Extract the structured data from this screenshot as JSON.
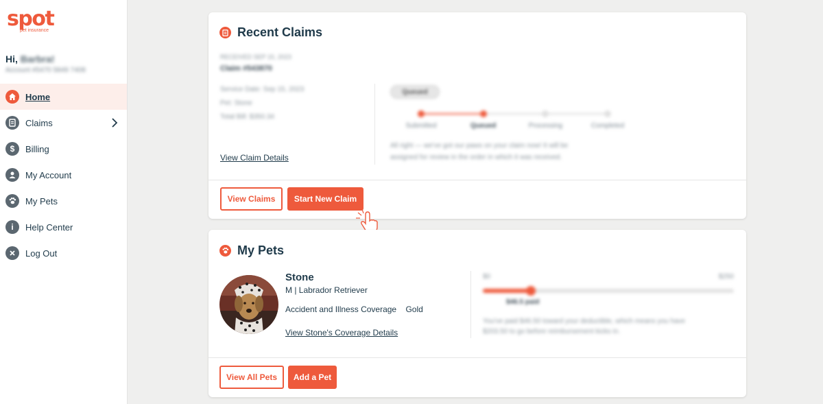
{
  "brand": {
    "logo_text": "spot",
    "logo_subtext": "pet insurance",
    "accent": "#ee5a3c",
    "navy": "#1f3a4a"
  },
  "user": {
    "greeting_prefix": "Hi, ",
    "name": "Barbra!",
    "account": "Account #5470 5849 7408"
  },
  "sidebar": {
    "items": [
      {
        "label": "Home",
        "icon": "home-icon",
        "active": true
      },
      {
        "label": "Claims",
        "icon": "clipboard-icon",
        "has_chevron": true
      },
      {
        "label": "Billing",
        "icon": "dollar-icon"
      },
      {
        "label": "My Account",
        "icon": "user-icon"
      },
      {
        "label": "My Pets",
        "icon": "paw-icon"
      },
      {
        "label": "Help Center",
        "icon": "info-icon"
      },
      {
        "label": "Log Out",
        "icon": "close-icon"
      }
    ]
  },
  "claims": {
    "title": "Recent Claims",
    "received": "RECEIVED SEP 15, 2023",
    "claim_number": "Claim #543870",
    "service_date": "Service Date: Sep 15, 2023",
    "pet": "Pet: Stone",
    "total_bill": "Total Bill: $350.34",
    "view_details_link": "View Claim Details",
    "status_pill": "Queued",
    "steps": [
      "Submitted",
      "Queued",
      "Processing",
      "Completed"
    ],
    "current_step": 2,
    "message_line1": "All right — we've got our paws on your claim now! It will be",
    "message_line2": "assigned for review in the order in which it was received.",
    "view_claims_button": "View Claims",
    "start_claim_button": "Start New Claim"
  },
  "pets": {
    "title": "My Pets",
    "pet": {
      "name": "Stone",
      "details": "M | Labrador Retriever",
      "coverage_label": "Accident and Illness Coverage",
      "coverage_tier": "Gold",
      "coverage_link": "View Stone's Coverage Details"
    },
    "deductible": {
      "min_label": "$0",
      "max_label": "$250",
      "paid_label": "$46.5 paid",
      "paid_fraction": 0.19,
      "message_line1": "You've paid $46.50 toward your deductible, which means you have",
      "message_line2": "$203.50 to go before reimbursement kicks in."
    },
    "view_all_button": "View All Pets",
    "add_button": "Add a Pet"
  }
}
